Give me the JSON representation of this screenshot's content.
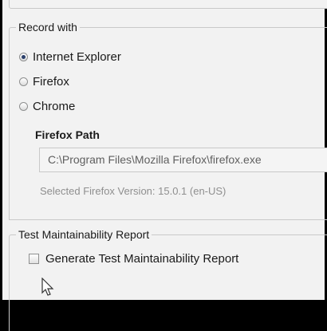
{
  "record_with": {
    "title": "Record with",
    "options": [
      {
        "label": "Internet Explorer",
        "selected": true
      },
      {
        "label": "Firefox",
        "selected": false
      },
      {
        "label": "Chrome",
        "selected": false
      }
    ],
    "firefox_path": {
      "label": "Firefox Path",
      "value": "C:\\Program Files\\Mozilla Firefox\\firefox.exe",
      "version_text": "Selected Firefox Version: 15.0.1 (en-US)"
    }
  },
  "report": {
    "title": "Test Maintainability Report",
    "checkbox_label": "Generate Test Maintainability Report",
    "checked": false
  }
}
